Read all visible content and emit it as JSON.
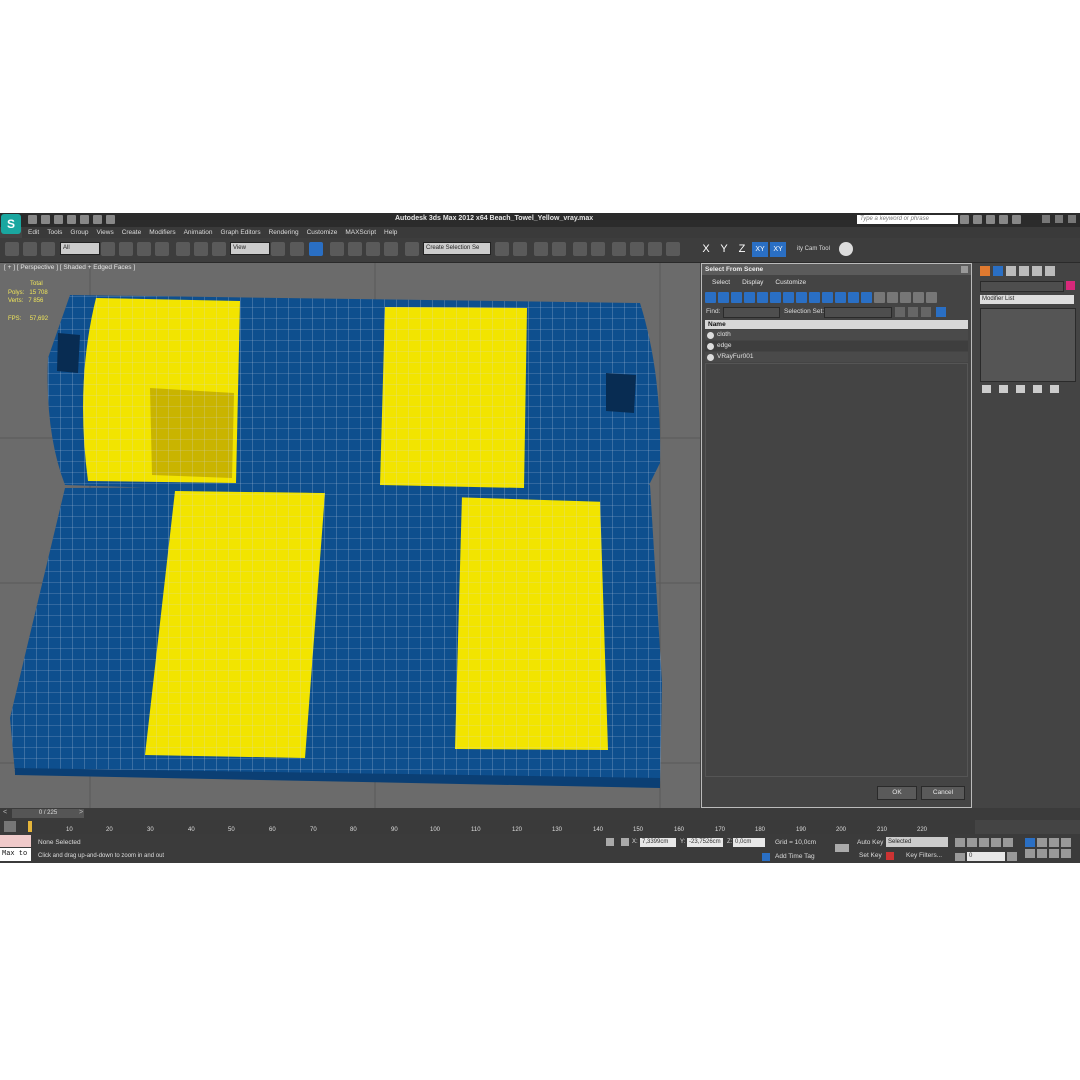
{
  "app": {
    "window_title": "Autodesk 3ds Max  2012 x64      Beach_Towel_Yellow_vray.max",
    "search_placeholder": "Type a keyword or phrase",
    "logo": "S"
  },
  "menu": [
    "Edit",
    "Tools",
    "Group",
    "Views",
    "Create",
    "Modifiers",
    "Animation",
    "Graph Editors",
    "Rendering",
    "Customize",
    "MAXScript",
    "Help"
  ],
  "toolbar": {
    "filter_value": "All",
    "refcoord_value": "View",
    "selection_set_placeholder": "Create Selection Se",
    "axes": [
      "X",
      "Y",
      "Z",
      "XY",
      "XY"
    ],
    "city_tool_label": "ity Cam Tool"
  },
  "viewport": {
    "label": "[ + ] [ Perspective ] [ Shaded + Edged Faces ]",
    "stats": {
      "total_label": "Total",
      "polys_label": "Polys:",
      "polys": "15 708",
      "verts_label": "Verts:",
      "verts": "7 856",
      "fps_label": "FPS:",
      "fps": "57,692"
    },
    "colors": {
      "blue": "#0e4f8e",
      "yellow": "#f2e400"
    }
  },
  "dialog": {
    "title": "Select From Scene",
    "menu": [
      "Select",
      "Display",
      "Customize"
    ],
    "find_label": "Find:",
    "selection_set_label": "Selection Set:",
    "column_name": "Name",
    "objects": [
      "cloth",
      "edge",
      "VRayFur001"
    ],
    "ok_label": "OK",
    "cancel_label": "Cancel"
  },
  "command_panel": {
    "modifier_list": "Modifier List"
  },
  "timeline": {
    "frame_counter": "0 / 225",
    "ticks": [
      "10",
      "20",
      "30",
      "40",
      "50",
      "60",
      "70",
      "80",
      "90",
      "100",
      "110",
      "120",
      "130",
      "140",
      "150",
      "160",
      "170",
      "180",
      "190",
      "200",
      "210",
      "220"
    ]
  },
  "status": {
    "selection": "None Selected",
    "prompt": "Click and drag up-and-down to zoom in and out",
    "x_label": "X:",
    "x": "7,3399cm",
    "y_label": "Y:",
    "y": "-23,7526cm",
    "z_label": "Z:",
    "z": "0,0cm",
    "grid": "Grid = 10,0cm",
    "add_time_tag": "Add Time Tag",
    "auto_key": "Auto Key",
    "set_key": "Set Key",
    "selected": "Selected",
    "key_filters": "Key Filters...",
    "frame": "0",
    "maxscript": "Max to"
  }
}
